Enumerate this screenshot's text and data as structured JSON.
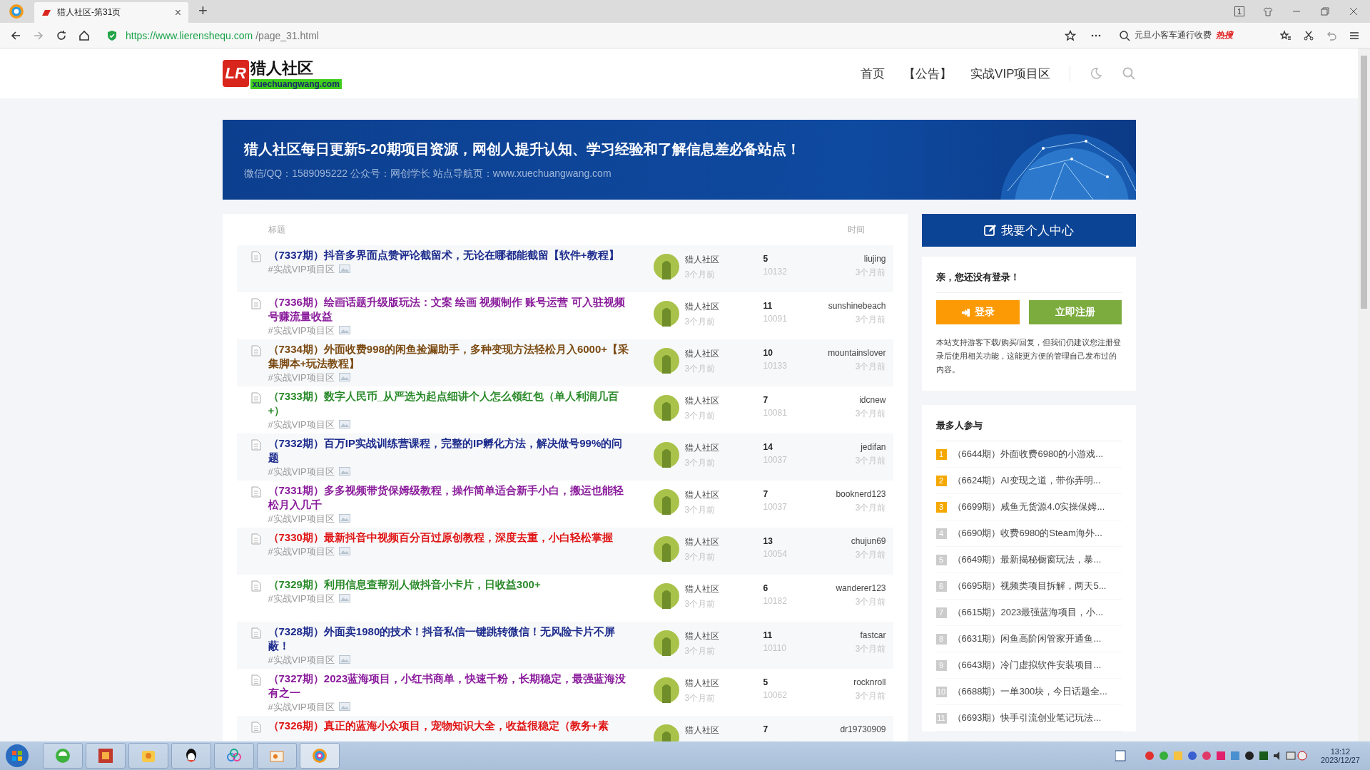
{
  "browser": {
    "tab_title": "猎人社区-第31页",
    "tab_close": "×",
    "new_tab": "+",
    "window_badge": "1",
    "url_host": "https://www.lierenshequ.com",
    "url_path": "/page_31.html",
    "search_hint": "元旦小客车通行收费",
    "hot_label": "热搜"
  },
  "site": {
    "logo_mark": "LR",
    "logo_name": "猎人社区",
    "logo_domain": "xuechuangwang.com",
    "nav": [
      {
        "label": "首页"
      },
      {
        "label": "【公告】"
      },
      {
        "label": "实战VIP项目区"
      }
    ]
  },
  "banner": {
    "headline": "猎人社区每日更新5-20期项目资源，网创人提升认知、学习经验和了解信息差必备站点！",
    "subline": "微信/QQ：1589095222 公众号：网创学长 站点导航页：www.xuechuangwang.com"
  },
  "table": {
    "columns": [
      "标题",
      "时间"
    ],
    "rows": [
      {
        "title": "（7337期）抖音多界面点赞评论截留术，无论在哪都能截留【软件+教程】",
        "color": "#1c2b8c",
        "tag": "#实战VIP项目区",
        "author": "猎人社区",
        "author_time": "3个月前",
        "replies": "5",
        "views": "10132",
        "last_user": "liujing",
        "last_time": "3个月前"
      },
      {
        "title": "（7336期）绘画话题升级版玩法：文案 绘画 视频制作 账号运营 可入驻视频号赚流量收益",
        "color": "#8a1c9c",
        "tag": "#实战VIP项目区",
        "author": "猎人社区",
        "author_time": "3个月前",
        "replies": "11",
        "views": "10091",
        "last_user": "sunshinebeach",
        "last_time": "3个月前"
      },
      {
        "title": "（7334期）外面收费998的闲鱼捡漏助手，多种变现方法轻松月入6000+【采集脚本+玩法教程】",
        "color": "#7b4a12",
        "tag": "#实战VIP项目区",
        "author": "猎人社区",
        "author_time": "3个月前",
        "replies": "10",
        "views": "10133",
        "last_user": "mountainslover",
        "last_time": "3个月前"
      },
      {
        "title": "（7333期）数字人民币_从严选为起点细讲个人怎么领红包（单人利润几百+）",
        "color": "#2a8a2a",
        "tag": "#实战VIP项目区",
        "author": "猎人社区",
        "author_time": "3个月前",
        "replies": "7",
        "views": "10081",
        "last_user": "idcnew",
        "last_time": "3个月前"
      },
      {
        "title": "（7332期）百万IP实战训练营课程，完整的IP孵化方法，解决做号99%的问题",
        "color": "#1c2b8c",
        "tag": "#实战VIP项目区",
        "author": "猎人社区",
        "author_time": "3个月前",
        "replies": "14",
        "views": "10037",
        "last_user": "jedifan",
        "last_time": "3个月前"
      },
      {
        "title": "（7331期）多多视频带货保姆级教程，操作简单适合新手小白，搬运也能轻松月入几千",
        "color": "#8a1c9c",
        "tag": "#实战VIP项目区",
        "author": "猎人社区",
        "author_time": "3个月前",
        "replies": "7",
        "views": "10037",
        "last_user": "booknerd123",
        "last_time": "3个月前"
      },
      {
        "title": "（7330期）最新抖音中视频百分百过原创教程，深度去重，小白轻松掌握",
        "color": "#e01414",
        "tag": "#实战VIP项目区",
        "author": "猎人社区",
        "author_time": "3个月前",
        "replies": "13",
        "views": "10054",
        "last_user": "chujun69",
        "last_time": "3个月前"
      },
      {
        "title": "（7329期）利用信息查帮别人做抖音小卡片，日收益300+",
        "color": "#2a8a2a",
        "tag": "#实战VIP项目区",
        "author": "猎人社区",
        "author_time": "3个月前",
        "replies": "6",
        "views": "10182",
        "last_user": "wanderer123",
        "last_time": "3个月前"
      },
      {
        "title": "（7328期）外面卖1980的技术！抖音私信一键跳转微信！无风险卡片不屏蔽！",
        "color": "#1c2b8c",
        "tag": "#实战VIP项目区",
        "author": "猎人社区",
        "author_time": "3个月前",
        "replies": "11",
        "views": "10110",
        "last_user": "fastcar",
        "last_time": "3个月前"
      },
      {
        "title": "（7327期）2023蓝海项目，小红书商单，快速千粉，长期稳定，最强蓝海没有之一",
        "color": "#8a1c9c",
        "tag": "#实战VIP项目区",
        "author": "猎人社区",
        "author_time": "3个月前",
        "replies": "5",
        "views": "10062",
        "last_user": "rocknroll",
        "last_time": "3个月前"
      },
      {
        "title": "（7326期）真正的蓝海小众项目，宠物知识大全，收益很稳定（教务+素",
        "color": "#e01414",
        "author": "猎人社区",
        "replies": "7",
        "last_user": "dr19730909"
      }
    ]
  },
  "sidebar": {
    "center_button": "我要个人中心",
    "login_prompt": "亲，您还没有登录！",
    "login_button": "登录",
    "register_button": "立即注册",
    "notice": "本站支持游客下载/购买/回复，但我们仍建议您注册登录后使用相关功能，这能更方便的管理自己发布过的内容。",
    "popular_title": "最多人参与",
    "popular": [
      {
        "rank": "1",
        "color": "#f5a800",
        "title": "（6644期）外面收费6980的小游戏..."
      },
      {
        "rank": "2",
        "color": "#f5a800",
        "title": "（6624期）AI变现之道，带你弄明..."
      },
      {
        "rank": "3",
        "color": "#f5a800",
        "title": "（6699期）咸鱼无货源4.0实操保姆..."
      },
      {
        "rank": "4",
        "color": "#cccccc",
        "title": "（6690期）收费6980的Steam海外..."
      },
      {
        "rank": "5",
        "color": "#cccccc",
        "title": "（6649期）最新揭秘橱窗玩法，暴..."
      },
      {
        "rank": "6",
        "color": "#cccccc",
        "title": "（6695期）视频类项目拆解，两天5..."
      },
      {
        "rank": "7",
        "color": "#cccccc",
        "title": "（6615期）2023最强蓝海项目，小..."
      },
      {
        "rank": "8",
        "color": "#cccccc",
        "title": "（6631期）闲鱼高阶闲管家开通鱼..."
      },
      {
        "rank": "9",
        "color": "#cccccc",
        "title": "（6643期）冷门虚拟软件安装项目..."
      },
      {
        "rank": "10",
        "color": "#cccccc",
        "title": "（6688期）一单300块，今日话题全..."
      },
      {
        "rank": "11",
        "color": "#cccccc",
        "title": "（6693期）快手引流创业笔记玩法..."
      }
    ]
  },
  "taskbar": {
    "time": "13:12",
    "date": "2023/12/27"
  }
}
